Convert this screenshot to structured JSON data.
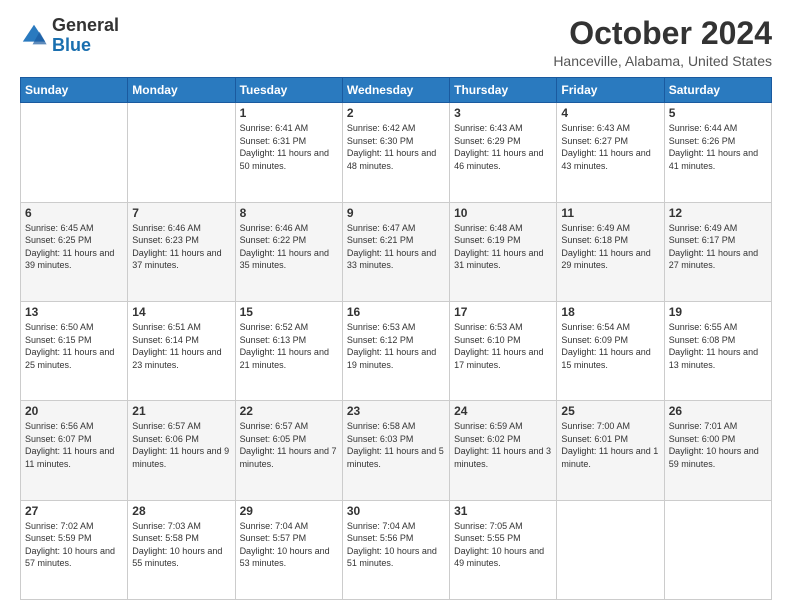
{
  "logo": {
    "general": "General",
    "blue": "Blue"
  },
  "header": {
    "month": "October 2024",
    "location": "Hanceville, Alabama, United States"
  },
  "weekdays": [
    "Sunday",
    "Monday",
    "Tuesday",
    "Wednesday",
    "Thursday",
    "Friday",
    "Saturday"
  ],
  "weeks": [
    [
      {
        "day": "",
        "info": ""
      },
      {
        "day": "",
        "info": ""
      },
      {
        "day": "1",
        "info": "Sunrise: 6:41 AM\nSunset: 6:31 PM\nDaylight: 11 hours and 50 minutes."
      },
      {
        "day": "2",
        "info": "Sunrise: 6:42 AM\nSunset: 6:30 PM\nDaylight: 11 hours and 48 minutes."
      },
      {
        "day": "3",
        "info": "Sunrise: 6:43 AM\nSunset: 6:29 PM\nDaylight: 11 hours and 46 minutes."
      },
      {
        "day": "4",
        "info": "Sunrise: 6:43 AM\nSunset: 6:27 PM\nDaylight: 11 hours and 43 minutes."
      },
      {
        "day": "5",
        "info": "Sunrise: 6:44 AM\nSunset: 6:26 PM\nDaylight: 11 hours and 41 minutes."
      }
    ],
    [
      {
        "day": "6",
        "info": "Sunrise: 6:45 AM\nSunset: 6:25 PM\nDaylight: 11 hours and 39 minutes."
      },
      {
        "day": "7",
        "info": "Sunrise: 6:46 AM\nSunset: 6:23 PM\nDaylight: 11 hours and 37 minutes."
      },
      {
        "day": "8",
        "info": "Sunrise: 6:46 AM\nSunset: 6:22 PM\nDaylight: 11 hours and 35 minutes."
      },
      {
        "day": "9",
        "info": "Sunrise: 6:47 AM\nSunset: 6:21 PM\nDaylight: 11 hours and 33 minutes."
      },
      {
        "day": "10",
        "info": "Sunrise: 6:48 AM\nSunset: 6:19 PM\nDaylight: 11 hours and 31 minutes."
      },
      {
        "day": "11",
        "info": "Sunrise: 6:49 AM\nSunset: 6:18 PM\nDaylight: 11 hours and 29 minutes."
      },
      {
        "day": "12",
        "info": "Sunrise: 6:49 AM\nSunset: 6:17 PM\nDaylight: 11 hours and 27 minutes."
      }
    ],
    [
      {
        "day": "13",
        "info": "Sunrise: 6:50 AM\nSunset: 6:15 PM\nDaylight: 11 hours and 25 minutes."
      },
      {
        "day": "14",
        "info": "Sunrise: 6:51 AM\nSunset: 6:14 PM\nDaylight: 11 hours and 23 minutes."
      },
      {
        "day": "15",
        "info": "Sunrise: 6:52 AM\nSunset: 6:13 PM\nDaylight: 11 hours and 21 minutes."
      },
      {
        "day": "16",
        "info": "Sunrise: 6:53 AM\nSunset: 6:12 PM\nDaylight: 11 hours and 19 minutes."
      },
      {
        "day": "17",
        "info": "Sunrise: 6:53 AM\nSunset: 6:10 PM\nDaylight: 11 hours and 17 minutes."
      },
      {
        "day": "18",
        "info": "Sunrise: 6:54 AM\nSunset: 6:09 PM\nDaylight: 11 hours and 15 minutes."
      },
      {
        "day": "19",
        "info": "Sunrise: 6:55 AM\nSunset: 6:08 PM\nDaylight: 11 hours and 13 minutes."
      }
    ],
    [
      {
        "day": "20",
        "info": "Sunrise: 6:56 AM\nSunset: 6:07 PM\nDaylight: 11 hours and 11 minutes."
      },
      {
        "day": "21",
        "info": "Sunrise: 6:57 AM\nSunset: 6:06 PM\nDaylight: 11 hours and 9 minutes."
      },
      {
        "day": "22",
        "info": "Sunrise: 6:57 AM\nSunset: 6:05 PM\nDaylight: 11 hours and 7 minutes."
      },
      {
        "day": "23",
        "info": "Sunrise: 6:58 AM\nSunset: 6:03 PM\nDaylight: 11 hours and 5 minutes."
      },
      {
        "day": "24",
        "info": "Sunrise: 6:59 AM\nSunset: 6:02 PM\nDaylight: 11 hours and 3 minutes."
      },
      {
        "day": "25",
        "info": "Sunrise: 7:00 AM\nSunset: 6:01 PM\nDaylight: 11 hours and 1 minute."
      },
      {
        "day": "26",
        "info": "Sunrise: 7:01 AM\nSunset: 6:00 PM\nDaylight: 10 hours and 59 minutes."
      }
    ],
    [
      {
        "day": "27",
        "info": "Sunrise: 7:02 AM\nSunset: 5:59 PM\nDaylight: 10 hours and 57 minutes."
      },
      {
        "day": "28",
        "info": "Sunrise: 7:03 AM\nSunset: 5:58 PM\nDaylight: 10 hours and 55 minutes."
      },
      {
        "day": "29",
        "info": "Sunrise: 7:04 AM\nSunset: 5:57 PM\nDaylight: 10 hours and 53 minutes."
      },
      {
        "day": "30",
        "info": "Sunrise: 7:04 AM\nSunset: 5:56 PM\nDaylight: 10 hours and 51 minutes."
      },
      {
        "day": "31",
        "info": "Sunrise: 7:05 AM\nSunset: 5:55 PM\nDaylight: 10 hours and 49 minutes."
      },
      {
        "day": "",
        "info": ""
      },
      {
        "day": "",
        "info": ""
      }
    ]
  ]
}
